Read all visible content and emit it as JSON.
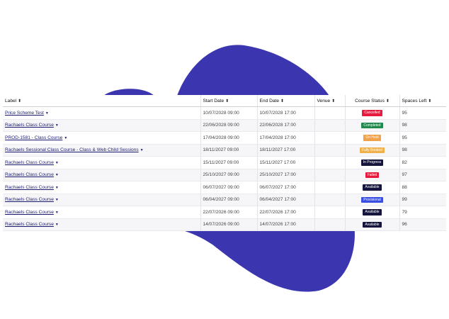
{
  "colors": {
    "blob": "#3b36b0",
    "cancelled": "#e8193f",
    "completed": "#1f8a4c",
    "on_hold": "#f0a24a",
    "fully_booked": "#f0b04a",
    "in_progress": "#14143c",
    "failed": "#e8193f",
    "available": "#14143c",
    "provisional": "#3a4fe0"
  },
  "table": {
    "headers": {
      "label": "Label",
      "start": "Start Date",
      "end": "End Date",
      "venue": "Venue",
      "status": "Course Status",
      "spaces": "Spaces Left"
    },
    "sort_icon": "sort-icon",
    "rows": [
      {
        "label": "Price Scheme Test",
        "start": "10/07/2028 09:00",
        "end": "10/07/2028 17:00",
        "venue": "",
        "status": "Cancelled",
        "status_color": "#e8193f",
        "spaces": "95"
      },
      {
        "label": "Rachaels Class Course",
        "start": "22/06/2028 09:00",
        "end": "22/06/2028 17:00",
        "venue": "",
        "status": "Completed",
        "status_color": "#1f8a4c",
        "spaces": "98"
      },
      {
        "label": "PROD-1581 - Class Course",
        "start": "17/04/2028 09:00",
        "end": "17/04/2028 17:00",
        "venue": "",
        "status": "On Hold",
        "status_color": "#f0a24a",
        "spaces": "95"
      },
      {
        "label": "Rachaels Sessional Class Course - Class & Web Child Sessions",
        "start": "18/11/2027 09:00",
        "end": "18/11/2027 17:00",
        "venue": "",
        "status": "Fully Booked",
        "status_color": "#f0b04a",
        "spaces": "98"
      },
      {
        "label": "Rachaels Class Course",
        "start": "15/11/2027 09:00",
        "end": "15/11/2027 17:00",
        "venue": "",
        "status": "In Progress",
        "status_color": "#14143c",
        "spaces": "82"
      },
      {
        "label": "Rachaels Class Course",
        "start": "25/10/2027 09:00",
        "end": "25/10/2027 17:00",
        "venue": "",
        "status": "Failed",
        "status_color": "#e8193f",
        "spaces": "97"
      },
      {
        "label": "Rachaels Class Course",
        "start": "06/07/2027 09:00",
        "end": "06/07/2027 17:00",
        "venue": "",
        "status": "Available",
        "status_color": "#14143c",
        "spaces": "88"
      },
      {
        "label": "Rachaels Class Course",
        "start": "06/04/2027 09:00",
        "end": "06/04/2027 17:00",
        "venue": "",
        "status": "Provisional",
        "status_color": "#3a4fe0",
        "spaces": "99"
      },
      {
        "label": "Rachaels Class Course",
        "start": "22/07/2026 09:00",
        "end": "22/07/2026 17:00",
        "venue": "",
        "status": "Available",
        "status_color": "#14143c",
        "spaces": "79"
      },
      {
        "label": "Rachaels Class Course",
        "start": "14/07/2026 09:00",
        "end": "14/07/2026 17:00",
        "venue": "",
        "status": "Available",
        "status_color": "#14143c",
        "spaces": "96"
      }
    ]
  }
}
